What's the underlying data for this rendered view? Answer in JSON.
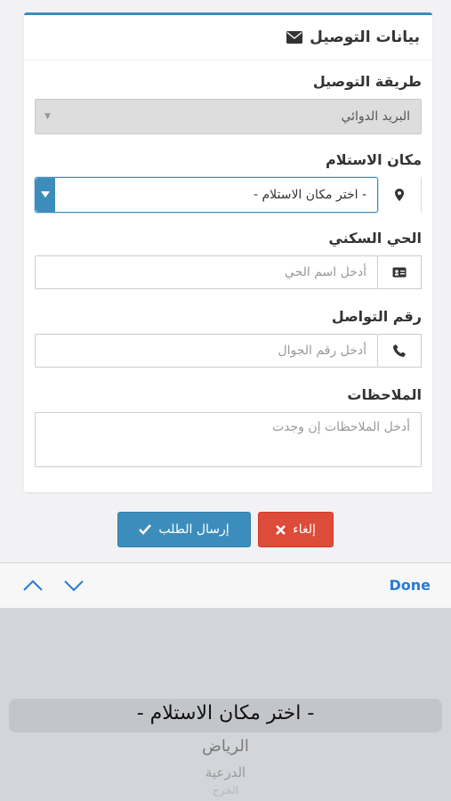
{
  "card": {
    "title": "بيانات التوصيل",
    "title_icon": "envelope-icon",
    "delivery_method": {
      "label": "طريقة التوصيل",
      "value": "البريد الدوائي"
    },
    "pickup_place": {
      "label": "مكان الاستلام",
      "value": "- اختر مكان الاستلام -",
      "icon": "map-marker-icon"
    },
    "district": {
      "label": "الحي السكني",
      "placeholder": "أدخل اسم الحي",
      "icon": "id-card-icon"
    },
    "phone": {
      "label": "رقم التواصل",
      "placeholder": "أدخل رقم الجوال",
      "icon": "phone-icon"
    },
    "notes": {
      "label": "الملاحظات",
      "placeholder": "أدخل الملاحظات إن وجدت"
    }
  },
  "actions": {
    "send_label": "إرسال الطلب",
    "cancel_label": "إلغاء"
  },
  "toolbar": {
    "done_label": "Done"
  },
  "picker": {
    "selected": "- اختر مكان الاستلام -",
    "options": [
      "الرياض",
      "الدرعية",
      "الخرج"
    ]
  },
  "colors": {
    "primary": "#3c8dbc",
    "danger": "#dd4b39",
    "ios_blue": "#2a7ad4"
  }
}
